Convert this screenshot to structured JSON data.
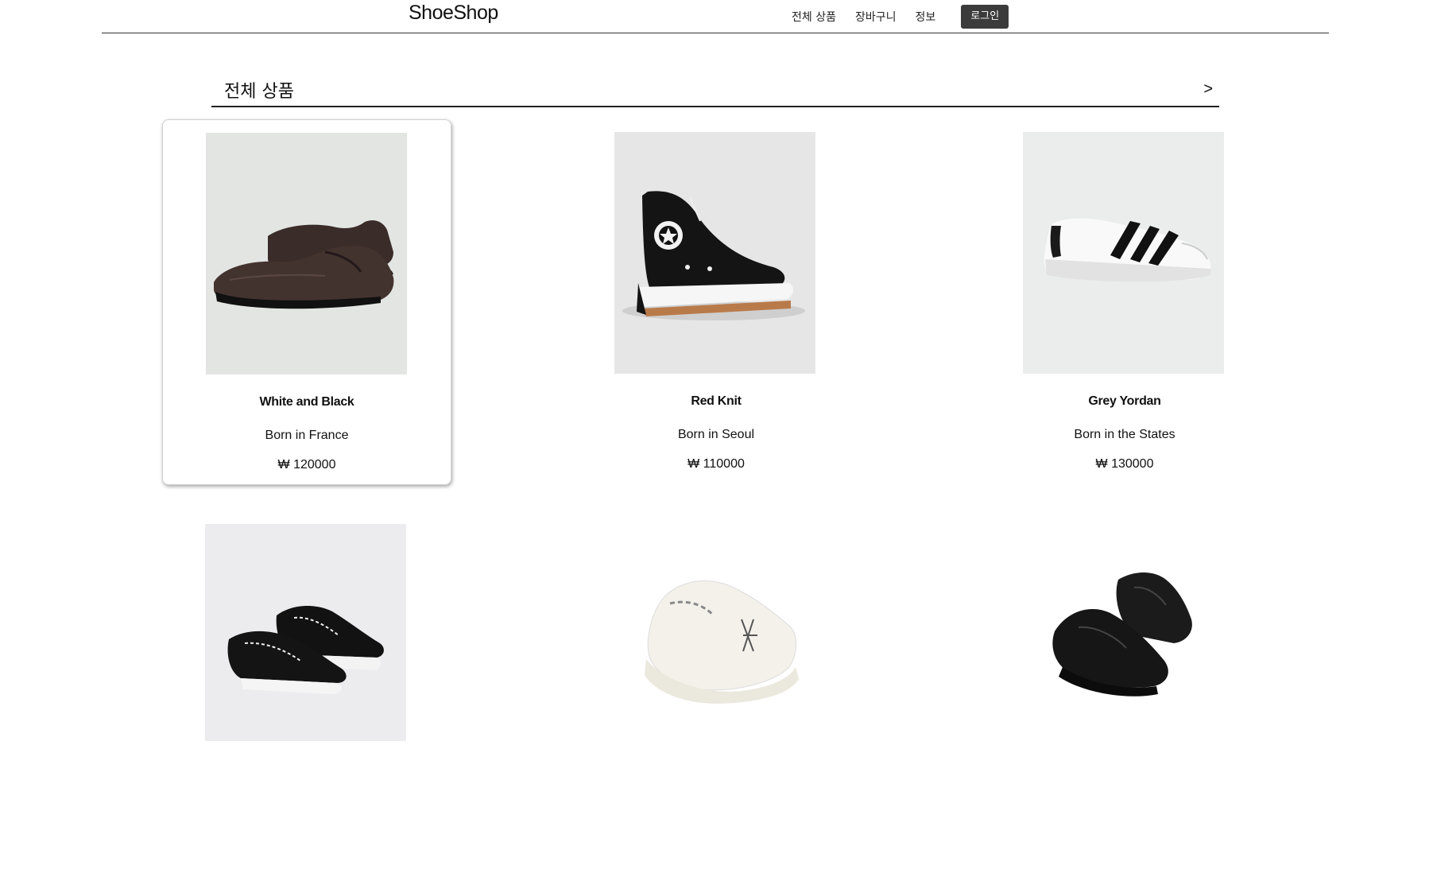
{
  "navbar": {
    "brand": "ShoeShop",
    "links": [
      "전체 상품",
      "장바구니",
      "정보"
    ],
    "login_label": "로그인"
  },
  "section": {
    "title": "전체 상품",
    "more_label": ">"
  },
  "products": [
    {
      "name": "White and Black",
      "desc": "Born in France",
      "price": "₩ 120000",
      "image": "brown-leather-derby-shoe"
    },
    {
      "name": "Red Knit",
      "desc": "Born in Seoul",
      "price": "₩ 110000",
      "image": "black-high-top-platform-sneaker"
    },
    {
      "name": "Grey Yordan",
      "desc": "Born in the States",
      "price": "₩ 130000",
      "image": "white-three-stripe-sneaker"
    },
    {
      "name": "",
      "desc": "",
      "price": "",
      "image": "black-low-top-canvas-sneaker"
    },
    {
      "name": "",
      "desc": "",
      "price": "",
      "image": "white-chunky-ny-sneaker"
    },
    {
      "name": "",
      "desc": "",
      "price": "",
      "image": "black-running-sneaker"
    }
  ],
  "colors": {
    "login_bg": "#3b3b3b",
    "divider": "#222222"
  }
}
